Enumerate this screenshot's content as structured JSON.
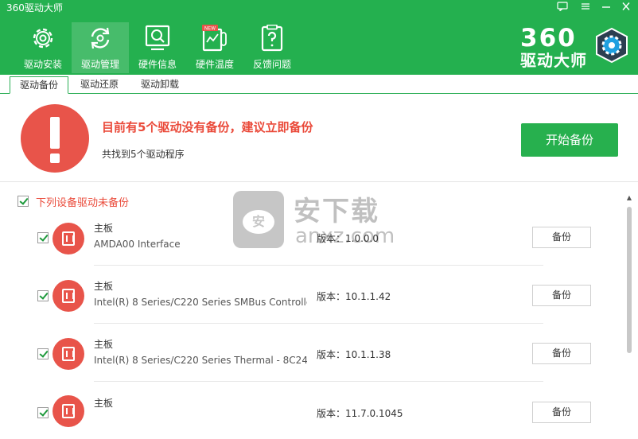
{
  "window": {
    "title": "360驱动大师",
    "controls": [
      "feedback-icon",
      "menu-icon",
      "minimize-icon",
      "close-icon"
    ]
  },
  "nav": {
    "items": [
      {
        "label": "驱动安装",
        "icon": "gear-icon",
        "active": false
      },
      {
        "label": "驱动管理",
        "icon": "refresh-icon",
        "active": true
      },
      {
        "label": "硬件信息",
        "icon": "monitor-search-icon",
        "active": false
      },
      {
        "label": "硬件温度",
        "icon": "thermometer-icon",
        "active": false,
        "badge": "NEW"
      },
      {
        "label": "反馈问题",
        "icon": "clipboard-question-icon",
        "active": false
      }
    ]
  },
  "brand": {
    "line1": "360",
    "line2": "驱动大师"
  },
  "tabs": [
    {
      "label": "驱动备份",
      "active": true
    },
    {
      "label": "驱动还原",
      "active": false
    },
    {
      "label": "驱动卸载",
      "active": false
    }
  ],
  "banner": {
    "title": "目前有5个驱动没有备份，建议立即备份",
    "subtitle": "共找到5个驱动程序",
    "button": "开始备份"
  },
  "section": {
    "label": "下列设备驱动未备份",
    "checked": true
  },
  "drivers": [
    {
      "type": "主板",
      "name": "AMDA00 Interface",
      "version": "版本：1.0.0.0",
      "button": "备份",
      "checked": true
    },
    {
      "type": "主板",
      "name": "Intel(R) 8 Series/C220 Series SMBus Controlle",
      "version": "版本：10.1.1.42",
      "button": "备份",
      "checked": true
    },
    {
      "type": "主板",
      "name": "Intel(R) 8 Series/C220 Series Thermal - 8C24",
      "version": "版本：10.1.1.38",
      "button": "备份",
      "checked": true
    },
    {
      "type": "主板",
      "name": "",
      "version": "版本：11.7.0.1045",
      "button": "备份",
      "checked": true
    }
  ],
  "watermark": {
    "cn": "安下载",
    "en": "anxz.com",
    "badge": "安"
  },
  "colors": {
    "header": "#24b04f",
    "accent_red": "#e8544a",
    "alert_text": "#ea4a3a",
    "button_green": "#27b04e"
  }
}
